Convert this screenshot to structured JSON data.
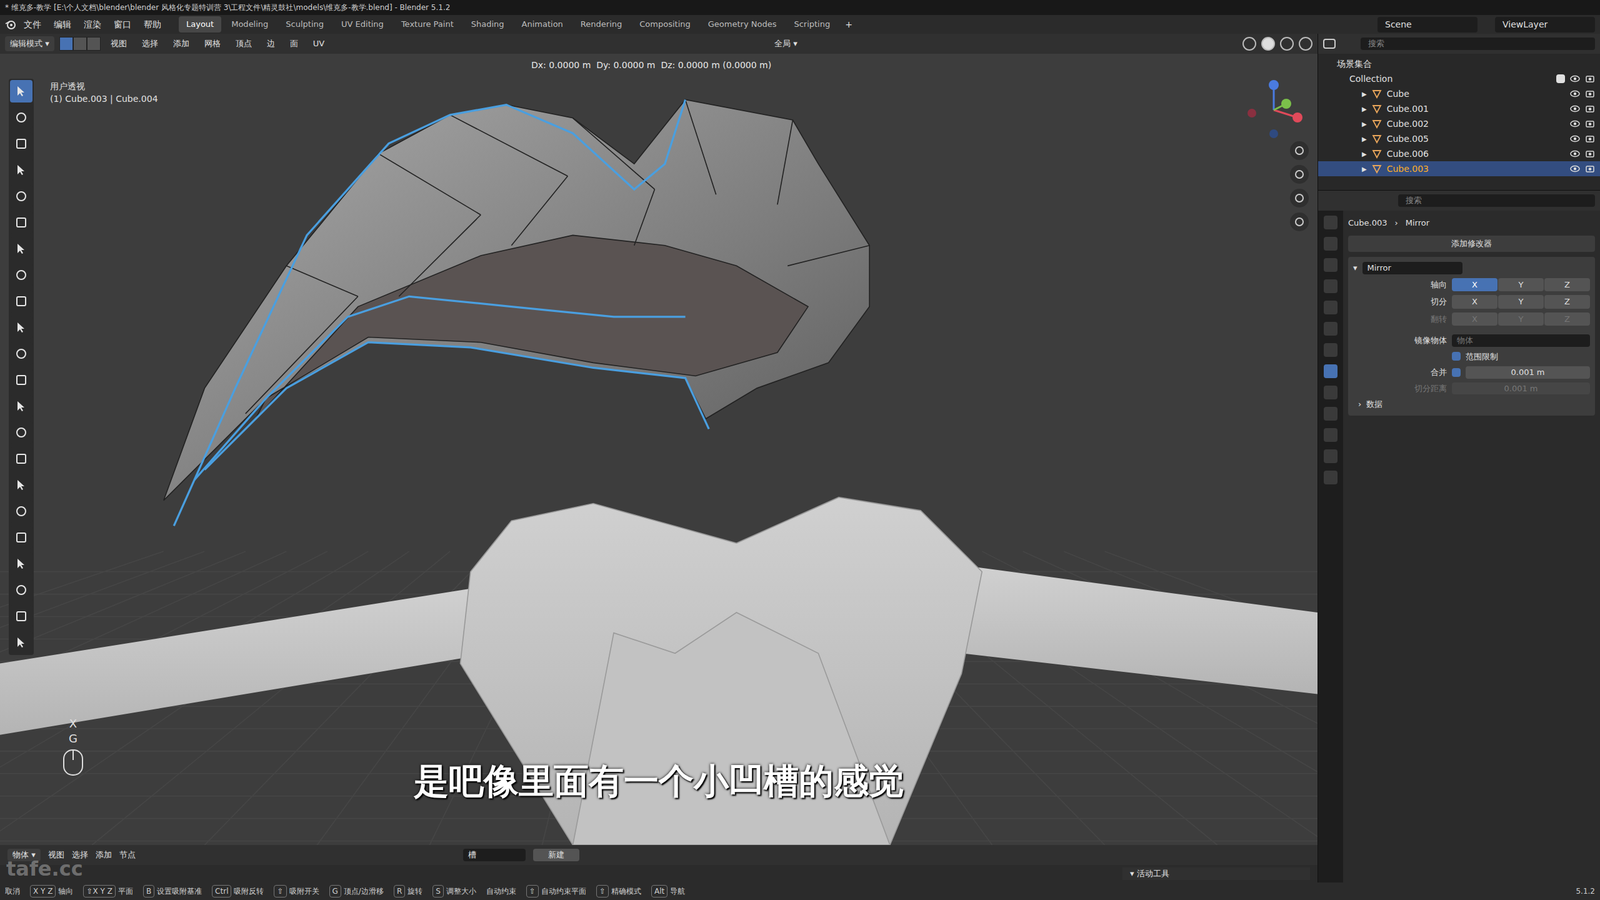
{
  "window": {
    "title": "* 维克多-教学 [E:\\个人文档\\blender\\blender 风格化专题特训营 3\\工程文件\\精灵鼓社\\models\\维克多-教学.blend] - Blender 5.1.2"
  },
  "menus": [
    "文件",
    "编辑",
    "渲染",
    "窗口",
    "帮助"
  ],
  "workspaces": [
    {
      "label": "Layout",
      "selected": true
    },
    {
      "label": "Modeling",
      "selected": false
    },
    {
      "label": "Sculpting",
      "selected": false
    },
    {
      "label": "UV Editing",
      "selected": false
    },
    {
      "label": "Texture Paint",
      "selected": false
    },
    {
      "label": "Shading",
      "selected": false
    },
    {
      "label": "Animation",
      "selected": false
    },
    {
      "label": "Rendering",
      "selected": false
    },
    {
      "label": "Compositing",
      "selected": false
    },
    {
      "label": "Geometry Nodes",
      "selected": false
    },
    {
      "label": "Scripting",
      "selected": false
    }
  ],
  "add_workspace": "+",
  "scene": "Scene",
  "view_layer": "ViewLayer",
  "viewport_header": {
    "mode": "编辑模式",
    "select_modes": [
      {
        "selected": true
      },
      {
        "selected": false
      },
      {
        "selected": false
      }
    ],
    "menus": [
      "视图",
      "选择",
      "添加",
      "网格",
      "顶点",
      "边",
      "面",
      "UV"
    ],
    "orientation": "全局"
  },
  "readout": "Dx: 0.0000 m  Dy: 0.0000 m  Dz: 0.0000 m (0.0000 m)",
  "viewport": {
    "view_name": "用户透视",
    "object_info": "(1) Cube.003 | Cube.004",
    "subtitle": "是吧像里面有一个小凹槽的感觉",
    "keys": [
      "X",
      "G"
    ],
    "watermark": "tafe.cc"
  },
  "tools": [
    {
      "selected": true
    },
    {
      "selected": false
    },
    {
      "selected": false
    },
    {
      "selected": false
    },
    {
      "selected": false
    },
    {
      "selected": false
    },
    {
      "selected": false
    },
    {
      "selected": false
    },
    {
      "selected": false
    },
    {
      "selected": false
    },
    {
      "selected": false
    },
    {
      "selected": false
    },
    {
      "selected": false
    },
    {
      "selected": false
    },
    {
      "selected": false
    },
    {
      "selected": false
    },
    {
      "selected": false
    },
    {
      "selected": false
    },
    {
      "selected": false
    },
    {
      "selected": false
    },
    {
      "selected": false
    },
    {
      "selected": false
    }
  ],
  "outliner": {
    "search": "搜索",
    "root": "场景集合",
    "collection": "Collection",
    "items": [
      {
        "name": "Cube",
        "selected": false
      },
      {
        "name": "Cube.001",
        "selected": false
      },
      {
        "name": "Cube.002",
        "selected": false
      },
      {
        "name": "Cube.005",
        "selected": false
      },
      {
        "name": "Cube.006",
        "selected": false
      },
      {
        "name": "Cube.003",
        "selected": true
      }
    ]
  },
  "properties": {
    "search": "搜索",
    "object": "Cube.003",
    "modifier_crumb": "Mirror",
    "add_modifier": "添加修改器",
    "modifier_name": "Mirror",
    "axis_rows": [
      {
        "label": "轴向",
        "disabled": false,
        "axes": [
          {
            "label": "X",
            "selected": true
          },
          {
            "label": "Y",
            "selected": false
          },
          {
            "label": "Z",
            "selected": false
          }
        ]
      },
      {
        "label": "切分",
        "disabled": false,
        "axes": [
          {
            "label": "X",
            "selected": false
          },
          {
            "label": "Y",
            "selected": false
          },
          {
            "label": "Z",
            "selected": false
          }
        ]
      },
      {
        "label": "翻转",
        "disabled": true,
        "axes": [
          {
            "label": "X",
            "selected": false
          },
          {
            "label": "Y",
            "selected": false
          },
          {
            "label": "Z",
            "selected": false
          }
        ]
      }
    ],
    "mirror_object_label": "镜像物体",
    "mirror_object_placeholder": "物体",
    "clip_label": "范围限制",
    "clip_checked": true,
    "merge_label": "合并",
    "merge_checked": true,
    "merge_value": "0.001 m",
    "bisect_label": "切分距离",
    "bisect_value": "0.001 m",
    "bisect_disabled": true,
    "data_label": "数据",
    "data_expanded": false
  },
  "timeline_header": {
    "mode": "物体",
    "menus": [
      "视图",
      "选择",
      "添加",
      "节点"
    ],
    "slot": "槽",
    "new": "新建",
    "active_tool": "活动工具"
  },
  "status_bar": {
    "items": [
      {
        "key": "",
        "label": "取消"
      },
      {
        "key": "X Y Z",
        "label": "轴向"
      },
      {
        "key": "⇧X Y Z",
        "label": "平面"
      },
      {
        "key": "B",
        "label": "设置吸附基准"
      },
      {
        "key": "Ctrl",
        "label": "吸附反转"
      },
      {
        "key": "⇧",
        "label": "吸附开关"
      },
      {
        "key": "G",
        "label": "顶点/边滑移"
      },
      {
        "key": "R",
        "label": "旋转"
      },
      {
        "key": "S",
        "label": "调整大小"
      },
      {
        "key": "",
        "label": "自动约束"
      },
      {
        "key": "⇧",
        "label": "自动约束平面"
      },
      {
        "key": "⇧",
        "label": "精确模式"
      },
      {
        "key": "Alt",
        "label": "导航"
      }
    ],
    "version": "5.1.2"
  }
}
